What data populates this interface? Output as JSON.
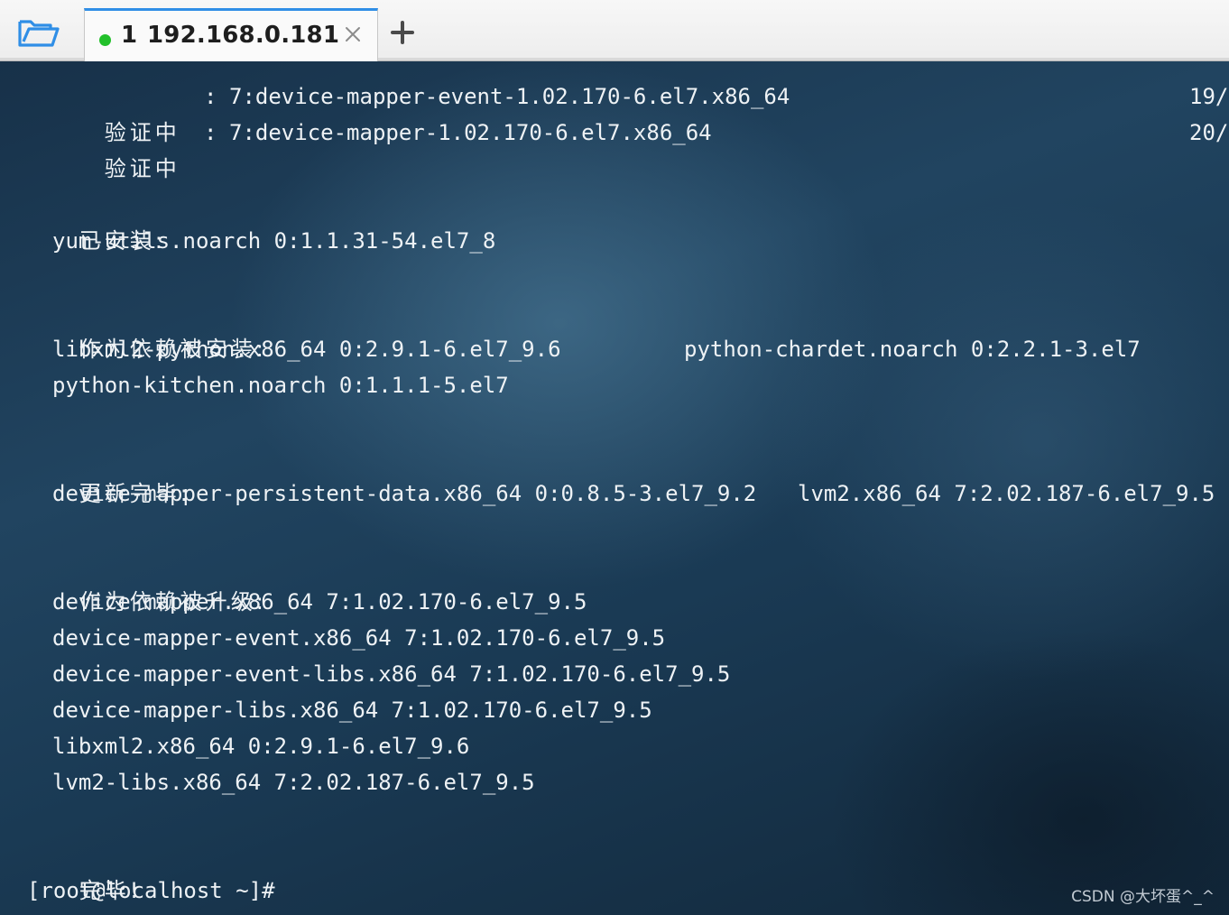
{
  "toolbar": {
    "open_icon": "folder-open-icon"
  },
  "tab": {
    "index": "1",
    "host": "192.168.0.181",
    "status_color": "#22c02a",
    "accent_color": "#2f8ee6"
  },
  "terminal": {
    "verify_rows": [
      {
        "label": "验证中",
        "sep": ":",
        "package": "7:device-mapper-event-1.02.170-6.el7.x86_64",
        "counter": "19/"
      },
      {
        "label": "验证中",
        "sep": ":",
        "package": "7:device-mapper-1.02.170-6.el7.x86_64",
        "counter": "20/"
      }
    ],
    "installed": {
      "heading": "已安装:",
      "items": [
        "yum-utils.noarch 0:1.1.31-54.el7_8"
      ]
    },
    "dep_installed": {
      "heading": "作为依赖被安装:",
      "items": [
        "libxml2-python.x86_64 0:2.9.1-6.el7_9.6",
        "python-chardet.noarch 0:2.2.1-3.el7",
        "python-kitchen.noarch 0:1.1.1-5.el7"
      ]
    },
    "updated": {
      "heading": "更新完毕:",
      "items": [
        "device-mapper-persistent-data.x86_64 0:0.8.5-3.el7_9.2",
        "lvm2.x86_64 7:2.02.187-6.el7_9.5"
      ]
    },
    "dep_updated": {
      "heading": "作为依赖被升级:",
      "items": [
        "device-mapper.x86_64 7:1.02.170-6.el7_9.5",
        "device-mapper-event.x86_64 7:1.02.170-6.el7_9.5",
        "device-mapper-event-libs.x86_64 7:1.02.170-6.el7_9.5",
        "device-mapper-libs.x86_64 7:1.02.170-6.el7_9.5",
        "libxml2.x86_64 0:2.9.1-6.el7_9.6",
        "lvm2-libs.x86_64 7:2.02.187-6.el7_9.5"
      ]
    },
    "done": "完毕!",
    "prompt": "[root@localhost ~]#"
  },
  "watermark": "CSDN @大坏蛋^_^"
}
